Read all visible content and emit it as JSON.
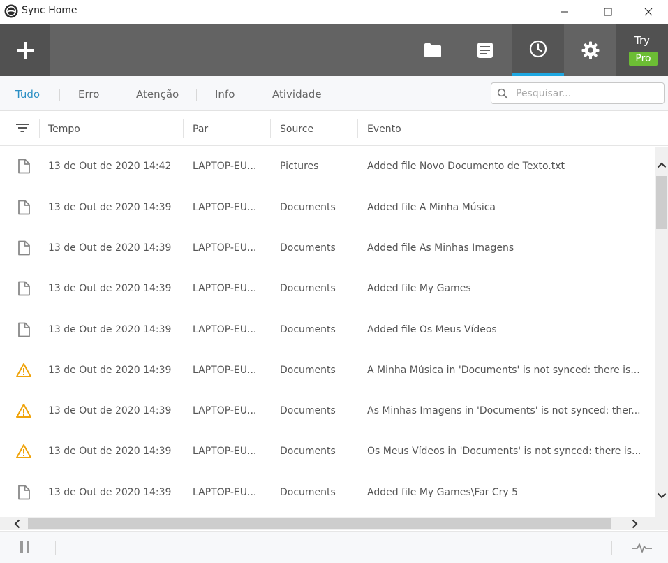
{
  "window": {
    "title": "Sync Home",
    "icon": "resilio-sync-logo-icon"
  },
  "toolbar": {
    "add_icon": "plus-icon",
    "buttons": [
      {
        "name": "folders",
        "icon": "folder-icon"
      },
      {
        "name": "notes",
        "icon": "notes-icon"
      },
      {
        "name": "history",
        "icon": "clock-icon",
        "active": true
      },
      {
        "name": "settings",
        "icon": "gear-icon"
      }
    ],
    "try_label": "Try",
    "pro_label": "Pro",
    "active_color": "#1ea7e1",
    "pro_color": "#6cbd34"
  },
  "filters": {
    "tabs": [
      "Tudo",
      "Erro",
      "Atenção",
      "Info",
      "Atividade"
    ],
    "active_index": 0
  },
  "search": {
    "placeholder": "Pesquisar...",
    "value": ""
  },
  "table": {
    "columns": [
      "Tempo",
      "Par",
      "Source",
      "Evento"
    ],
    "rows": [
      {
        "type": "file",
        "time": "13 de Out de 2020 14:42",
        "peer": "LAPTOP-EU...",
        "source": "Pictures",
        "event": "Added file Novo Documento de Texto.txt"
      },
      {
        "type": "file",
        "time": "13 de Out de 2020 14:39",
        "peer": "LAPTOP-EU...",
        "source": "Documents",
        "event": "Added file A Minha Música"
      },
      {
        "type": "file",
        "time": "13 de Out de 2020 14:39",
        "peer": "LAPTOP-EU...",
        "source": "Documents",
        "event": "Added file As Minhas Imagens"
      },
      {
        "type": "file",
        "time": "13 de Out de 2020 14:39",
        "peer": "LAPTOP-EU...",
        "source": "Documents",
        "event": "Added file My Games"
      },
      {
        "type": "file",
        "time": "13 de Out de 2020 14:39",
        "peer": "LAPTOP-EU...",
        "source": "Documents",
        "event": "Added file Os Meus Vídeos"
      },
      {
        "type": "warning",
        "time": "13 de Out de 2020 14:39",
        "peer": "LAPTOP-EU...",
        "source": "Documents",
        "event": "A Minha Música in 'Documents' is not synced: there is..."
      },
      {
        "type": "warning",
        "time": "13 de Out de 2020 14:39",
        "peer": "LAPTOP-EU...",
        "source": "Documents",
        "event": "As Minhas Imagens in 'Documents' is not synced: ther..."
      },
      {
        "type": "warning",
        "time": "13 de Out de 2020 14:39",
        "peer": "LAPTOP-EU...",
        "source": "Documents",
        "event": "Os Meus Vídeos in 'Documents' is not synced: there is..."
      },
      {
        "type": "file",
        "time": "13 de Out de 2020 14:39",
        "peer": "LAPTOP-EU...",
        "source": "Documents",
        "event": "Added file My Games\\Far Cry 5"
      }
    ]
  },
  "statusbar": {
    "pause_icon": "pause-icon",
    "activity_icon": "activity-pulse-icon"
  }
}
